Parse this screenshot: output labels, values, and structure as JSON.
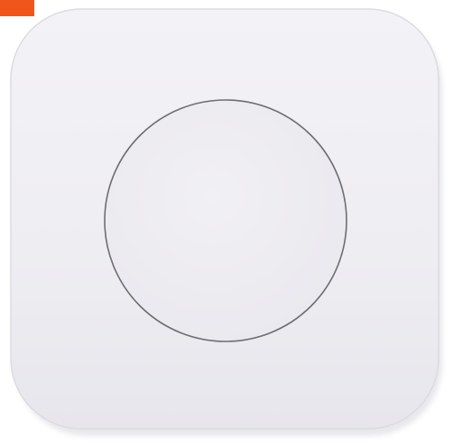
{
  "image": {
    "subject": "wireless-mini-switch",
    "colors": {
      "background": "#ffffff",
      "device_body": "#efeef3",
      "device_edge": "#dcdbe2",
      "button_outline": "#6e6e72",
      "corner_badge": "#f0561a"
    }
  }
}
